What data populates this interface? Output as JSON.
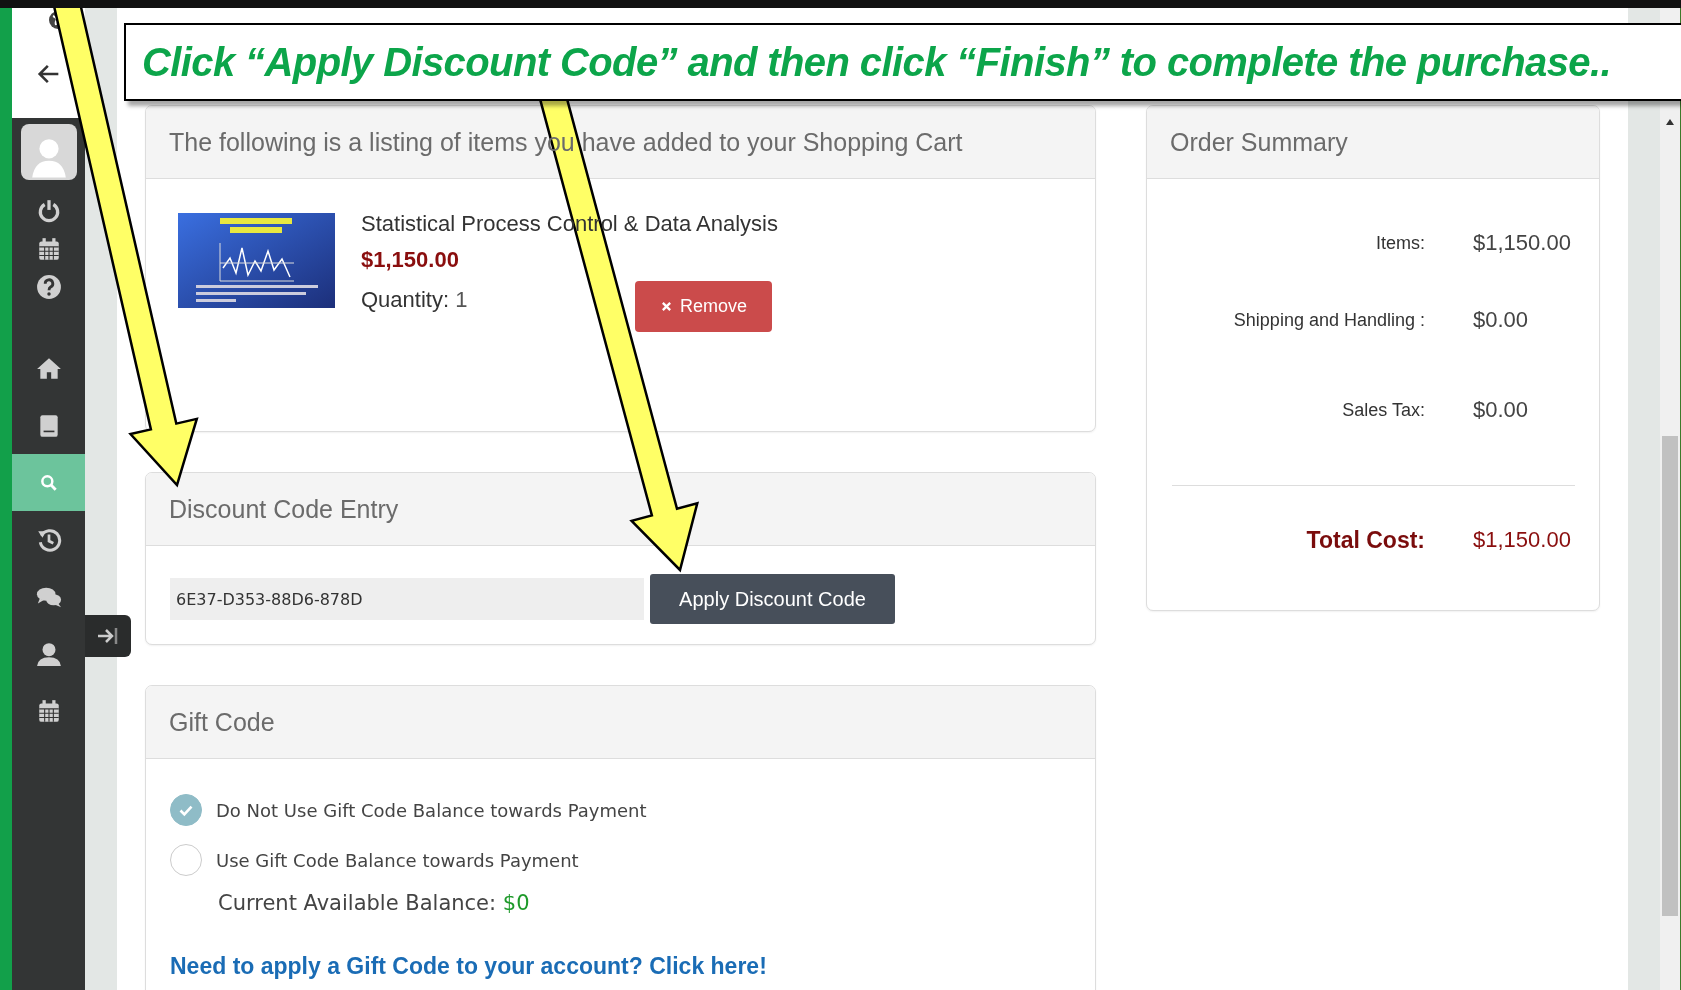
{
  "annotation": {
    "text": "Click “Apply Discount Code” and then click “Finish” to complete the purchase.."
  },
  "sidebar": {
    "items": [
      {
        "kind": "power",
        "selected": false
      },
      {
        "kind": "calendar",
        "selected": false
      },
      {
        "kind": "help",
        "selected": false
      },
      {
        "kind": "home",
        "selected": false
      },
      {
        "kind": "book",
        "selected": false
      },
      {
        "kind": "search",
        "selected": true
      },
      {
        "kind": "history",
        "selected": false
      },
      {
        "kind": "chat",
        "selected": false
      },
      {
        "kind": "user",
        "selected": false
      },
      {
        "kind": "calendar",
        "selected": false
      }
    ]
  },
  "cart": {
    "heading": "The following is a listing of items you have added to your Shopping Cart",
    "items": [
      {
        "title": "Statistical Process Control & Data Analysis",
        "price": "$1,150.00",
        "quantity_label": "Quantity:",
        "quantity": "1",
        "remove": "Remove"
      }
    ]
  },
  "discount": {
    "heading": "Discount Code Entry",
    "code": "6E37-D353-88D6-878D",
    "button": "Apply Discount Code"
  },
  "gift": {
    "heading": "Gift Code",
    "options": [
      {
        "label": "Do Not Use Gift Code Balance towards Payment",
        "selected": true
      },
      {
        "label": "Use Gift Code Balance towards Payment",
        "selected": false
      }
    ],
    "balance_label": "Current Available Balance:",
    "balance": "$0",
    "link": "Need to apply a Gift Code to your account? Click here!"
  },
  "summary": {
    "heading": "Order Summary",
    "rows": [
      {
        "kind": "line",
        "label": "Items:",
        "value": "$1,150.00"
      },
      {
        "kind": "line",
        "label": "Shipping and Handling :",
        "value": "$0.00"
      },
      {
        "kind": "line",
        "label": "Sales Tax:",
        "value": "$0.00"
      },
      {
        "kind": "total",
        "label": "Total Cost:",
        "value": "$1,150.00"
      }
    ]
  }
}
